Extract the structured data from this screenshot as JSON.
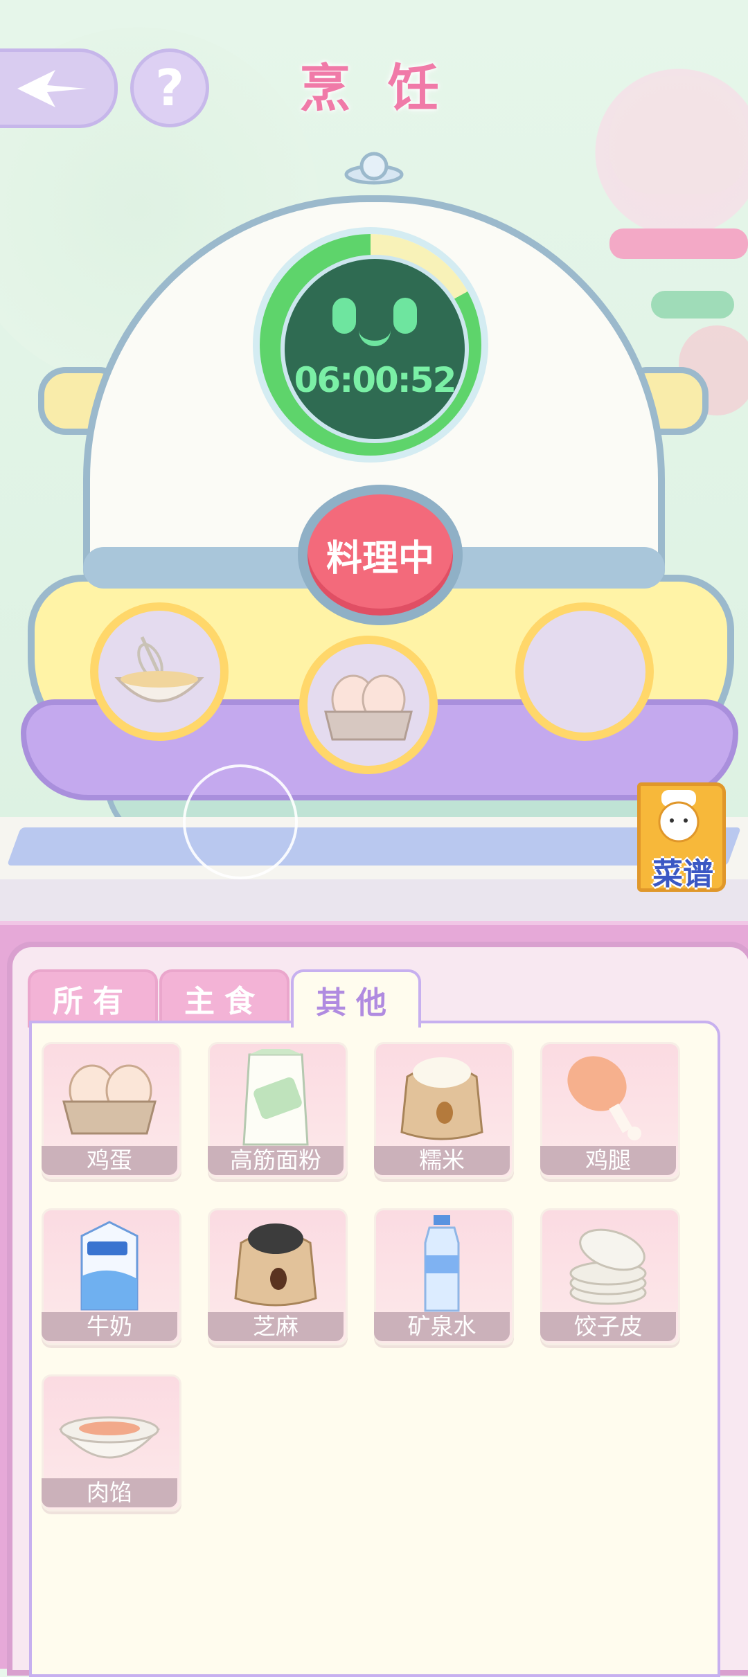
{
  "header": {
    "title": "烹 饪",
    "help_label": "?"
  },
  "cooker": {
    "timer": "06:00:52",
    "timer_progress": 0.83,
    "status_label": "料理中",
    "slots": [
      "whisk-bowl",
      "egg-carton",
      "empty"
    ]
  },
  "recipe": {
    "label": "菜谱"
  },
  "tabs": [
    {
      "label": "所有",
      "active": false
    },
    {
      "label": "主食",
      "active": false
    },
    {
      "label": "其他",
      "active": true
    }
  ],
  "ingredients": [
    {
      "name": "鸡蛋",
      "icon": "eggs-icon"
    },
    {
      "name": "高筋面粉",
      "icon": "flour-bag-icon"
    },
    {
      "name": "糯米",
      "icon": "rice-sack-icon"
    },
    {
      "name": "鸡腿",
      "icon": "chicken-leg-icon"
    },
    {
      "name": "牛奶",
      "icon": "milk-carton-icon"
    },
    {
      "name": "芝麻",
      "icon": "sesame-sack-icon"
    },
    {
      "name": "矿泉水",
      "icon": "water-bottle-icon"
    },
    {
      "name": "饺子皮",
      "icon": "dumpling-wrappers-icon"
    },
    {
      "name": "肉馅",
      "icon": "minced-meat-bowl-icon"
    }
  ],
  "colors": {
    "title": "#f07aa8",
    "panel": "#e6a9d8",
    "timer_green": "#5ed46b",
    "status_red": "#f36a7b"
  }
}
